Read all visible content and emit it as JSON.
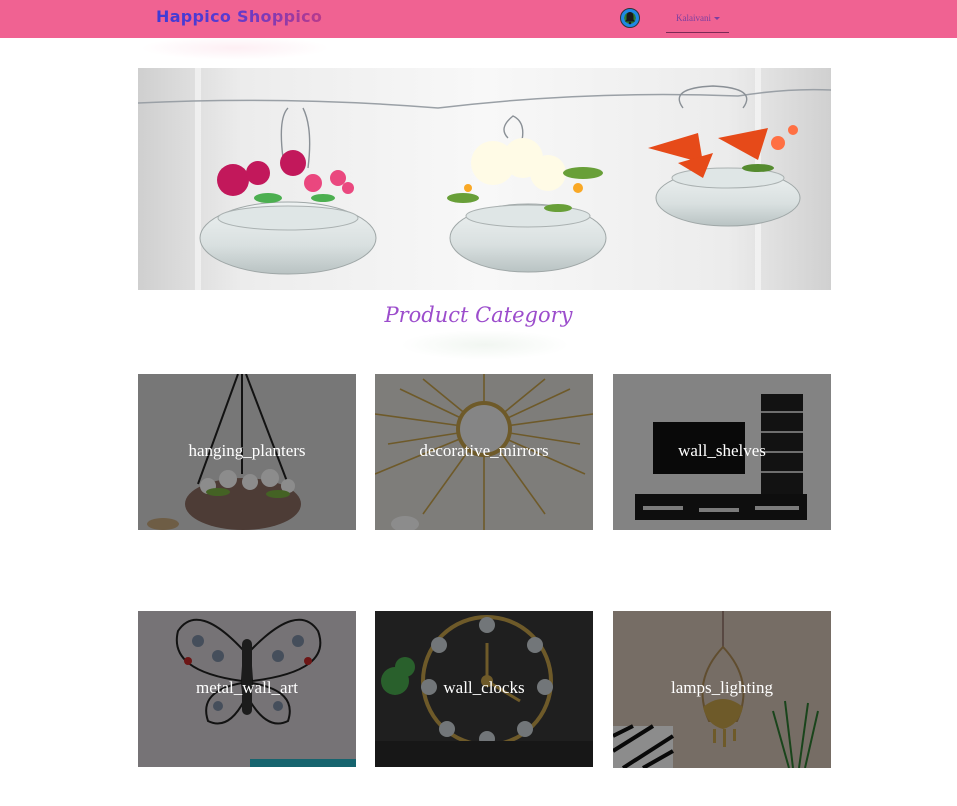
{
  "header": {
    "brand": "Happico Shoppico",
    "user_name": "Kalaivani",
    "avatar_icon": "bell-avatar-icon",
    "background": "#f06292"
  },
  "hero": {
    "image": "hanging-glass-vases-with-flowers"
  },
  "main": {
    "section_title": "Product Category",
    "title_color": "#9c4dcc",
    "categories": [
      {
        "label": "hanging_planters"
      },
      {
        "label": "decorative_mirrors"
      },
      {
        "label": "wall_shelves"
      },
      {
        "label": "metal_wall_art"
      },
      {
        "label": "wall_clocks"
      },
      {
        "label": "lamps_lighting"
      }
    ]
  }
}
